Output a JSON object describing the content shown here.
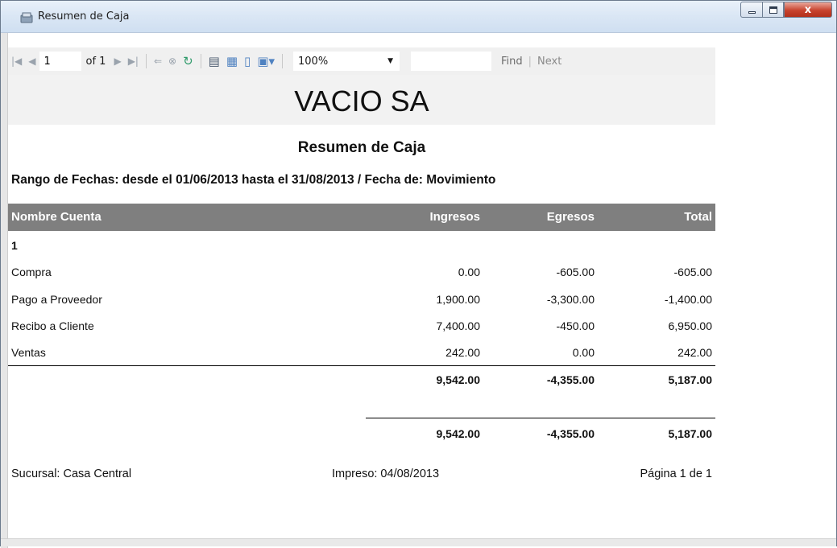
{
  "window": {
    "title": "Resumen de Caja",
    "controls": {
      "close": "x"
    }
  },
  "toolbar": {
    "current_page": "1",
    "of_pages": "of 1",
    "zoom": "100%",
    "find_label": "Find",
    "separator": "|",
    "next_label": "Next"
  },
  "report": {
    "company": "VACIO SA",
    "title": "Resumen de Caja",
    "date_range": "Rango de Fechas: desde el 01/06/2013 hasta el 31/08/2013 / Fecha de: Movimiento",
    "columns": {
      "account": "Nombre Cuenta",
      "income": "Ingresos",
      "expense": "Egresos",
      "total": "Total"
    },
    "group": "1",
    "rows": [
      {
        "account": "Compra",
        "income": "0.00",
        "expense": "-605.00",
        "total": "-605.00"
      },
      {
        "account": "Pago a Proveedor",
        "income": "1,900.00",
        "expense": "-3,300.00",
        "total": "-1,400.00"
      },
      {
        "account": "Recibo a Cliente",
        "income": "7,400.00",
        "expense": "-450.00",
        "total": "6,950.00"
      },
      {
        "account": "Ventas",
        "income": "242.00",
        "expense": "0.00",
        "total": "242.00"
      }
    ],
    "group_total": {
      "income": "9,542.00",
      "expense": "-4,355.00",
      "total": "5,187.00"
    },
    "grand_total": {
      "income": "9,542.00",
      "expense": "-4,355.00",
      "total": "5,187.00"
    },
    "footer": {
      "branch": "Sucursal: Casa Central",
      "printed": "Impreso: 04/08/2013",
      "page": "Página 1 de 1"
    }
  },
  "colors": {
    "header_band": "#7f7f7f",
    "company_band": "#f2f2f2",
    "close_button": "#c8432e"
  }
}
